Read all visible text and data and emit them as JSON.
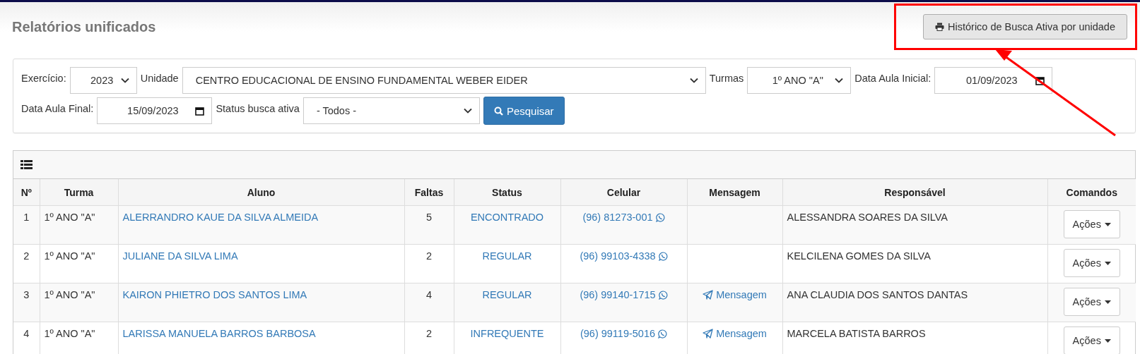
{
  "page": {
    "title": "Relatórios unificados"
  },
  "print_button": {
    "label": "Histórico de Busca Ativa por unidade"
  },
  "filters": [
    {
      "kind": "select",
      "label": "Exercício:",
      "value": "2023"
    },
    {
      "kind": "select",
      "label": "Unidade",
      "value": "CENTRO EDUCACIONAL DE ENSINO FUNDAMENTAL WEBER EIDER"
    },
    {
      "kind": "select",
      "label": "Turmas",
      "value": "1º ANO \"A\""
    },
    {
      "kind": "date",
      "label": "Data Aula Inicial:",
      "value": "01/09/2023"
    },
    {
      "kind": "date",
      "label": "Data Aula Final:",
      "value": "15/09/2023"
    },
    {
      "kind": "select",
      "label": "Status busca ativa",
      "value": "- Todos -"
    }
  ],
  "search_button": {
    "label": "Pesquisar"
  },
  "table": {
    "columns": [
      "Nº",
      "Turma",
      "Aluno",
      "Faltas",
      "Status",
      "Celular",
      "Mensagem",
      "Responsável",
      "Comandos"
    ],
    "rows": [
      {
        "no": "1",
        "turma": "1º ANO \"A\"",
        "aluno": "ALERRANDRO KAUE DA SILVA ALMEIDA",
        "faltas": "5",
        "status": "ENCONTRADO",
        "celular": "(96) 81273-001",
        "mensagem": null,
        "responsavel": "ALESSANDRA SOARES DA SILVA",
        "acoes": "Ações"
      },
      {
        "no": "2",
        "turma": "1º ANO \"A\"",
        "aluno": "JULIANE DA SILVA LIMA",
        "faltas": "2",
        "status": "REGULAR",
        "celular": "(96) 99103-4338",
        "mensagem": null,
        "responsavel": "KELCILENA GOMES DA SILVA",
        "acoes": "Ações"
      },
      {
        "no": "3",
        "turma": "1º ANO \"A\"",
        "aluno": "KAIRON PHIETRO DOS SANTOS LIMA",
        "faltas": "4",
        "status": "REGULAR",
        "celular": "(96) 99140-1715",
        "mensagem": "Mensagem",
        "responsavel": "ANA CLAUDIA DOS SANTOS DANTAS",
        "acoes": "Ações"
      },
      {
        "no": "4",
        "turma": "1º ANO \"A\"",
        "aluno": "LARISSA MANUELA BARROS BARBOSA",
        "faltas": "2",
        "status": "INFREQUENTE",
        "celular": "(96) 99119-5016",
        "mensagem": "Mensagem",
        "responsavel": "MARCELA BATISTA BARROS",
        "acoes": "Ações"
      }
    ]
  }
}
